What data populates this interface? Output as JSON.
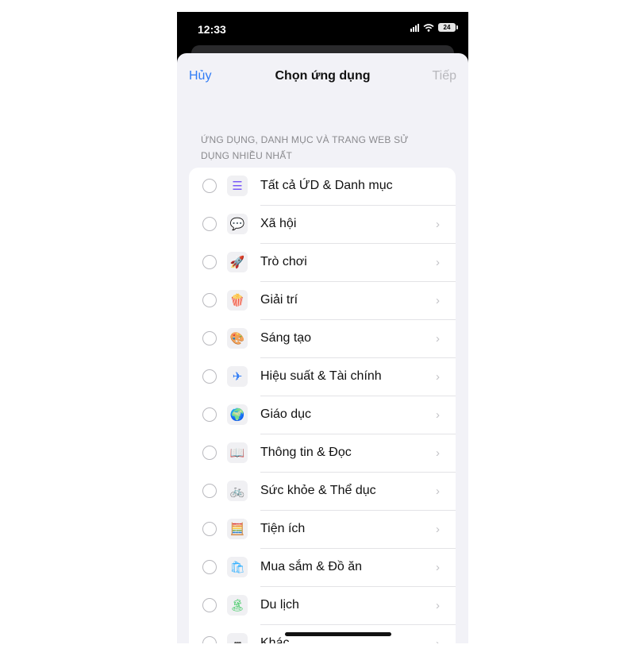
{
  "status_bar": {
    "time": "12:33",
    "battery": "24"
  },
  "nav": {
    "cancel": "Hủy",
    "title": "Chọn ứng dụng",
    "next": "Tiếp"
  },
  "section_header": "ỨNG DỤNG, DANH MỤC VÀ TRANG WEB SỬ DỤNG NHIỀU NHẤT",
  "items": [
    {
      "label": "Tất cả ỨD & Danh mục",
      "icon": "stack-layers-icon",
      "glyph": "☰",
      "color": "#7a5af8",
      "chevron": false
    },
    {
      "label": "Xã hội",
      "icon": "chat-bubble-icon",
      "glyph": "💬",
      "color": "#ff3b6b",
      "chevron": true
    },
    {
      "label": "Trò chơi",
      "icon": "rocket-icon",
      "glyph": "🚀",
      "color": "#3aa0ff",
      "chevron": true
    },
    {
      "label": "Giải trí",
      "icon": "popcorn-icon",
      "glyph": "🍿",
      "color": "#ff453a",
      "chevron": true
    },
    {
      "label": "Sáng tạo",
      "icon": "palette-icon",
      "glyph": "🎨",
      "color": "#ffb300",
      "chevron": true
    },
    {
      "label": "Hiệu suất & Tài chính",
      "icon": "paper-plane-icon",
      "glyph": "✈",
      "color": "#2f7cf6",
      "chevron": true
    },
    {
      "label": "Giáo dục",
      "icon": "globe-icon",
      "glyph": "🌍",
      "color": "#34c759",
      "chevron": true
    },
    {
      "label": "Thông tin & Đọc",
      "icon": "book-icon",
      "glyph": "📖",
      "color": "#2f7cf6",
      "chevron": true
    },
    {
      "label": "Sức khỏe & Thể dục",
      "icon": "bicycle-icon",
      "glyph": "🚲",
      "color": "#2f7cf6",
      "chevron": true
    },
    {
      "label": "Tiện ích",
      "icon": "calculator-icon",
      "glyph": "🧮",
      "color": "#555555",
      "chevron": true
    },
    {
      "label": "Mua sắm & Đồ ăn",
      "icon": "shopping-bag-icon",
      "glyph": "🛍",
      "color": "#30b0ff",
      "chevron": true
    },
    {
      "label": "Du lịch",
      "icon": "palm-tree-icon",
      "glyph": "🏝",
      "color": "#34c759",
      "chevron": true
    },
    {
      "label": "Khác",
      "icon": "more-dots-icon",
      "glyph": "•••",
      "color": "#555555",
      "chevron": true
    }
  ]
}
